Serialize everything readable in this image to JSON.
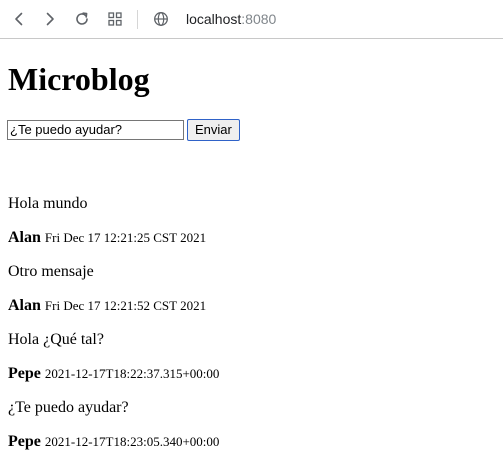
{
  "browser": {
    "address_host": "localhost",
    "address_port": ":8080",
    "icons": {
      "back": "arrow-left-icon",
      "forward": "arrow-right-icon",
      "reload": "reload-icon",
      "apps": "apps-grid-icon",
      "site": "globe-icon"
    }
  },
  "page": {
    "title": "Microblog",
    "composer": {
      "input_value": "¿Te puedo ayudar?",
      "send_label": "Enviar"
    },
    "posts": [
      {
        "text": "Hola mundo",
        "author": "Alan",
        "date": "Fri Dec 17 12:21:25 CST 2021"
      },
      {
        "text": "Otro mensaje",
        "author": "Alan",
        "date": "Fri Dec 17 12:21:52 CST 2021"
      },
      {
        "text": "Hola ¿Qué tal?",
        "author": "Pepe",
        "date": "2021-12-17T18:22:37.315+00:00"
      },
      {
        "text": "¿Te puedo ayudar?",
        "author": "Pepe",
        "date": "2021-12-17T18:23:05.340+00:00"
      }
    ]
  },
  "colors": {
    "button_border": "#2f62c8",
    "port_text": "#80868b",
    "toolbar_divider": "#c8c8c8"
  }
}
